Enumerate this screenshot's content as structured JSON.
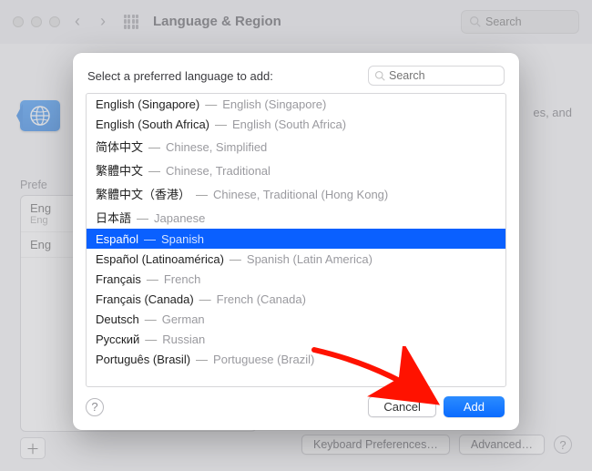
{
  "window": {
    "title": "Language & Region",
    "toolbar_search_placeholder": "Search"
  },
  "background": {
    "description_fragment": "es, and",
    "preferred_label": "Prefe",
    "preferred_list": [
      {
        "line1_prefix": "Eng",
        "line2_prefix": "Eng"
      },
      {
        "line1_prefix": "Eng",
        "line2": ""
      }
    ],
    "buttons": {
      "keyboard_prefs": "Keyboard Preferences…",
      "advanced": "Advanced…"
    }
  },
  "modal": {
    "prompt": "Select a preferred language to add:",
    "search_placeholder": "Search",
    "languages": [
      {
        "native": "English (Singapore)",
        "english": "English (Singapore)",
        "selected": false
      },
      {
        "native": "English (South Africa)",
        "english": "English (South Africa)",
        "selected": false
      },
      {
        "native": "简体中文",
        "english": "Chinese, Simplified",
        "selected": false
      },
      {
        "native": "繁體中文",
        "english": "Chinese, Traditional",
        "selected": false
      },
      {
        "native": "繁體中文（香港）",
        "english": "Chinese, Traditional (Hong Kong)",
        "selected": false
      },
      {
        "native": "日本語",
        "english": "Japanese",
        "selected": false
      },
      {
        "native": "Español",
        "english": "Spanish",
        "selected": true
      },
      {
        "native": "Español (Latinoamérica)",
        "english": "Spanish (Latin America)",
        "selected": false
      },
      {
        "native": "Français",
        "english": "French",
        "selected": false
      },
      {
        "native": "Français (Canada)",
        "english": "French (Canada)",
        "selected": false
      },
      {
        "native": "Deutsch",
        "english": "German",
        "selected": false
      },
      {
        "native": "Русский",
        "english": "Russian",
        "selected": false
      },
      {
        "native": "Português (Brasil)",
        "english": "Portuguese (Brazil)",
        "selected": false
      }
    ],
    "buttons": {
      "cancel": "Cancel",
      "add": "Add"
    }
  }
}
